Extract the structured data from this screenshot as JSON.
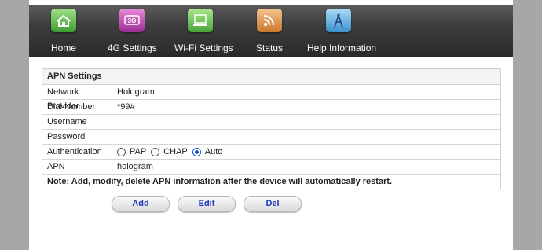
{
  "nav": {
    "items": [
      {
        "label": "Home",
        "icon": "home-icon"
      },
      {
        "label": "4G Settings",
        "icon": "4g-icon",
        "icon_text": "3G"
      },
      {
        "label": "Wi-Fi Settings",
        "icon": "wifi-settings-icon"
      },
      {
        "label": "Status",
        "icon": "rss-status-icon"
      },
      {
        "label": "Help Information",
        "icon": "antenna-icon"
      }
    ]
  },
  "apn": {
    "title": "APN Settings",
    "rows": {
      "network_provider": {
        "label": "Network Provider",
        "value": "Hologram"
      },
      "dial_number": {
        "label": "Dial Number",
        "value": "*99#"
      },
      "username": {
        "label": "Username",
        "value": ""
      },
      "password": {
        "label": "Password",
        "value": ""
      },
      "authentication": {
        "label": "Authentication",
        "options": [
          "PAP",
          "CHAP",
          "Auto"
        ],
        "selected": "Auto"
      },
      "apn": {
        "label": "APN",
        "value": "hologram"
      }
    },
    "note": "Note: Add, modify, delete APN information after the device will automatically restart."
  },
  "buttons": {
    "add": "Add",
    "edit": "Edit",
    "del": "Del"
  },
  "colors": {
    "accent": "#1a4fd8",
    "button_text": "#1d3bbd",
    "nav_bg": "#3b3b3b"
  }
}
